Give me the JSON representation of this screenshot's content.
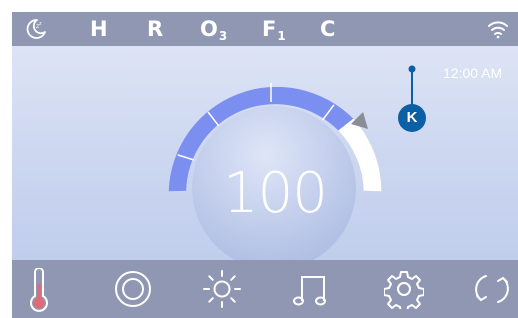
{
  "status_bar": {
    "indicators": [
      {
        "icon": "sleep-moon-icon"
      },
      {
        "text": "H"
      },
      {
        "text": "R"
      },
      {
        "text": "O",
        "sub": "3"
      },
      {
        "text": "F",
        "sub": "1"
      },
      {
        "text": "C"
      },
      {
        "icon": "wifi-icon"
      }
    ]
  },
  "clock": {
    "time": "12:00 AM"
  },
  "marker": {
    "label": "K"
  },
  "temperature": {
    "setpoint": "100"
  },
  "nav": {
    "items": [
      {
        "icon": "thermometer-icon"
      },
      {
        "icon": "target-icon"
      },
      {
        "icon": "sun-icon"
      },
      {
        "icon": "music-note-icon"
      },
      {
        "icon": "gear-icon"
      },
      {
        "icon": "refresh-icon"
      }
    ]
  },
  "colors": {
    "bar": "#8f97b2",
    "gauge_fill": "#7b8ff0",
    "accent": "#0c5fa5",
    "thermometer": "#e06b76"
  }
}
